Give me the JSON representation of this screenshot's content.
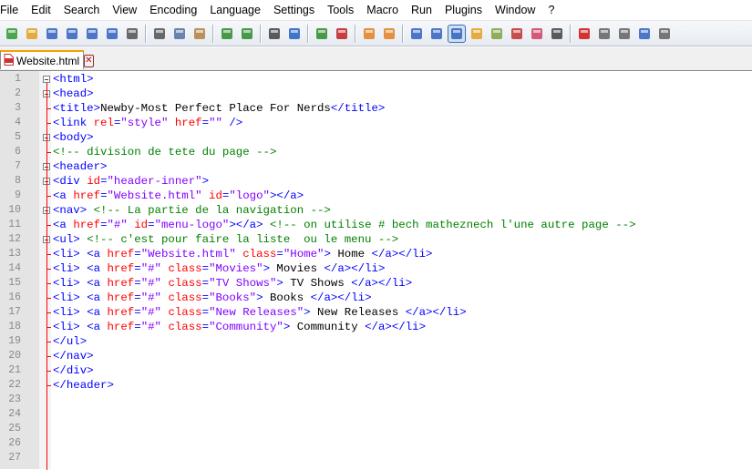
{
  "menubar": [
    "File",
    "Edit",
    "Search",
    "View",
    "Encoding",
    "Language",
    "Settings",
    "Tools",
    "Macro",
    "Run",
    "Plugins",
    "Window",
    "?"
  ],
  "toolbar": {
    "icons": [
      {
        "name": "new-file-icon",
        "color": "#2f9a2f"
      },
      {
        "name": "open-file-icon",
        "color": "#e0a020"
      },
      {
        "name": "save-icon",
        "color": "#3060c0"
      },
      {
        "name": "save-all-icon",
        "color": "#3060c0"
      },
      {
        "name": "close-icon",
        "color": "#3060c0"
      },
      {
        "name": "close-all-icon",
        "color": "#3060c0"
      },
      {
        "name": "print-icon",
        "color": "#505050"
      },
      {
        "sep": true
      },
      {
        "name": "cut-icon",
        "color": "#505050"
      },
      {
        "name": "copy-icon",
        "color": "#5070a0"
      },
      {
        "name": "paste-icon",
        "color": "#b08040"
      },
      {
        "sep": true
      },
      {
        "name": "undo-icon",
        "color": "#2a8a2a"
      },
      {
        "name": "redo-icon",
        "color": "#2a8a2a"
      },
      {
        "sep": true
      },
      {
        "name": "find-icon",
        "color": "#404040"
      },
      {
        "name": "replace-icon",
        "color": "#2060c0"
      },
      {
        "sep": true
      },
      {
        "name": "zoom-in-icon",
        "color": "#2a8a2a"
      },
      {
        "name": "zoom-out-icon",
        "color": "#c02020"
      },
      {
        "sep": true
      },
      {
        "name": "sync-vertical-icon",
        "color": "#e08020"
      },
      {
        "name": "sync-horizontal-icon",
        "color": "#e08020"
      },
      {
        "sep": true
      },
      {
        "name": "word-wrap-icon",
        "color": "#3060c0"
      },
      {
        "name": "show-all-chars-icon",
        "color": "#3060c0"
      },
      {
        "name": "indent-guide-icon",
        "color": "#3060c0",
        "active": true
      },
      {
        "name": "user-defined-language-icon",
        "color": "#e0a020"
      },
      {
        "name": "document-map-icon",
        "color": "#80a040"
      },
      {
        "name": "function-list-icon",
        "color": "#c03030"
      },
      {
        "name": "folder-as-workspace-icon",
        "color": "#d04060"
      },
      {
        "name": "monitoring-icon",
        "color": "#404040"
      },
      {
        "sep": true
      },
      {
        "name": "record-macro-icon",
        "color": "#d01010"
      },
      {
        "name": "stop-macro-icon",
        "color": "#606060"
      },
      {
        "name": "play-macro-icon",
        "color": "#606060"
      },
      {
        "name": "run-macro-multiple-icon",
        "color": "#3060c0"
      },
      {
        "name": "save-macro-icon",
        "color": "#606060"
      }
    ]
  },
  "tab": {
    "label": "Website.html",
    "icon": "file-html-icon",
    "close_icon": "close-tab-icon"
  },
  "line_numbers": [
    "1",
    "2",
    "3",
    "4",
    "5",
    "6",
    "7",
    "8",
    "9",
    "10",
    "11",
    "12",
    "13",
    "14",
    "15",
    "16",
    "17",
    "18",
    "19",
    "20",
    "21",
    "22",
    "23",
    "24",
    "25",
    "26",
    "27"
  ],
  "code_lines": [
    [
      [
        "t",
        "<html>"
      ]
    ],
    [
      [
        "t",
        "<head>"
      ]
    ],
    [
      [
        "t",
        "<title>"
      ],
      [
        "x",
        "Newby-Most Perfect Place For Nerds"
      ],
      [
        "t",
        "</title>"
      ]
    ],
    [
      [
        "t",
        "<link "
      ],
      [
        "a",
        "rel"
      ],
      [
        "t",
        "="
      ],
      [
        "s",
        "\"style\""
      ],
      [
        "x",
        " "
      ],
      [
        "a",
        "href"
      ],
      [
        "t",
        "="
      ],
      [
        "s",
        "\"\""
      ],
      [
        "x",
        " "
      ],
      [
        "t",
        "/>"
      ]
    ],
    [
      [
        "t",
        "<body>"
      ]
    ],
    [
      [
        "c",
        "<!-- division de tete du page -->"
      ]
    ],
    [
      [
        "t",
        "<header>"
      ]
    ],
    [
      [
        "t",
        "<div "
      ],
      [
        "a",
        "id"
      ],
      [
        "t",
        "="
      ],
      [
        "s",
        "\"header-inner\""
      ],
      [
        "t",
        ">"
      ]
    ],
    [
      [
        "t",
        "<a "
      ],
      [
        "a",
        "href"
      ],
      [
        "t",
        "="
      ],
      [
        "s",
        "\"Website.html\""
      ],
      [
        "x",
        " "
      ],
      [
        "a",
        "id"
      ],
      [
        "t",
        "="
      ],
      [
        "s",
        "\"logo\""
      ],
      [
        "t",
        "></a>"
      ]
    ],
    [
      [
        "t",
        "<nav>"
      ],
      [
        "x",
        " "
      ],
      [
        "c",
        "<!-- La partie de la navigation -->"
      ]
    ],
    [
      [
        "t",
        "<a "
      ],
      [
        "a",
        "href"
      ],
      [
        "t",
        "="
      ],
      [
        "s",
        "\"#\""
      ],
      [
        "x",
        " "
      ],
      [
        "a",
        "id"
      ],
      [
        "t",
        "="
      ],
      [
        "s",
        "\"menu-logo\""
      ],
      [
        "t",
        "></a>"
      ],
      [
        "x",
        " "
      ],
      [
        "c",
        "<!-- on utilise # bech matheznech l'une autre page -->"
      ]
    ],
    [
      [
        "t",
        "<ul>"
      ],
      [
        "x",
        " "
      ],
      [
        "c",
        "<!-- c'est pour faire la liste  ou le menu -->"
      ]
    ],
    [
      [
        "t",
        "<li>"
      ],
      [
        "x",
        " "
      ],
      [
        "t",
        "<a "
      ],
      [
        "a",
        "href"
      ],
      [
        "t",
        "="
      ],
      [
        "s",
        "\"Website.html\""
      ],
      [
        "x",
        " "
      ],
      [
        "a",
        "class"
      ],
      [
        "t",
        "="
      ],
      [
        "s",
        "\"Home\""
      ],
      [
        "t",
        ">"
      ],
      [
        "x",
        " Home "
      ],
      [
        "t",
        "</a></li>"
      ]
    ],
    [
      [
        "t",
        "<li>"
      ],
      [
        "x",
        " "
      ],
      [
        "t",
        "<a "
      ],
      [
        "a",
        "href"
      ],
      [
        "t",
        "="
      ],
      [
        "s",
        "\"#\""
      ],
      [
        "x",
        " "
      ],
      [
        "a",
        "class"
      ],
      [
        "t",
        "="
      ],
      [
        "s",
        "\"Movies\""
      ],
      [
        "t",
        ">"
      ],
      [
        "x",
        " Movies "
      ],
      [
        "t",
        "</a></li>"
      ]
    ],
    [
      [
        "t",
        "<li>"
      ],
      [
        "x",
        " "
      ],
      [
        "t",
        "<a "
      ],
      [
        "a",
        "href"
      ],
      [
        "t",
        "="
      ],
      [
        "s",
        "\"#\""
      ],
      [
        "x",
        " "
      ],
      [
        "a",
        "class"
      ],
      [
        "t",
        "="
      ],
      [
        "s",
        "\"TV Shows\""
      ],
      [
        "t",
        ">"
      ],
      [
        "x",
        " TV Shows "
      ],
      [
        "t",
        "</a></li>"
      ]
    ],
    [
      [
        "t",
        "<li>"
      ],
      [
        "x",
        " "
      ],
      [
        "t",
        "<a "
      ],
      [
        "a",
        "href"
      ],
      [
        "t",
        "="
      ],
      [
        "s",
        "\"#\""
      ],
      [
        "x",
        " "
      ],
      [
        "a",
        "class"
      ],
      [
        "t",
        "="
      ],
      [
        "s",
        "\"Books\""
      ],
      [
        "t",
        ">"
      ],
      [
        "x",
        " Books "
      ],
      [
        "t",
        "</a></li>"
      ]
    ],
    [
      [
        "t",
        "<li>"
      ],
      [
        "x",
        " "
      ],
      [
        "t",
        "<a "
      ],
      [
        "a",
        "href"
      ],
      [
        "t",
        "="
      ],
      [
        "s",
        "\"#\""
      ],
      [
        "x",
        " "
      ],
      [
        "a",
        "class"
      ],
      [
        "t",
        "="
      ],
      [
        "s",
        "\"New Releases\""
      ],
      [
        "t",
        ">"
      ],
      [
        "x",
        " New Releases "
      ],
      [
        "t",
        "</a></li>"
      ]
    ],
    [
      [
        "t",
        "<li>"
      ],
      [
        "x",
        " "
      ],
      [
        "t",
        "<a "
      ],
      [
        "a",
        "href"
      ],
      [
        "t",
        "="
      ],
      [
        "s",
        "\"#\""
      ],
      [
        "x",
        " "
      ],
      [
        "a",
        "class"
      ],
      [
        "t",
        "="
      ],
      [
        "s",
        "\"Community\""
      ],
      [
        "t",
        ">"
      ],
      [
        "x",
        " Community "
      ],
      [
        "t",
        "</a></li>"
      ]
    ],
    [
      [
        "t",
        "</ul>"
      ]
    ],
    [
      [
        "t",
        "</nav>"
      ]
    ],
    [
      [
        "t",
        "</div>"
      ]
    ],
    [
      [
        "t",
        "</header>"
      ]
    ],
    [],
    [],
    [],
    [],
    []
  ],
  "syntax_colors": {
    "tag": "#0000ff",
    "attribute": "#ff0000",
    "string": "#8000ff",
    "comment": "#008000",
    "text": "#000000"
  }
}
